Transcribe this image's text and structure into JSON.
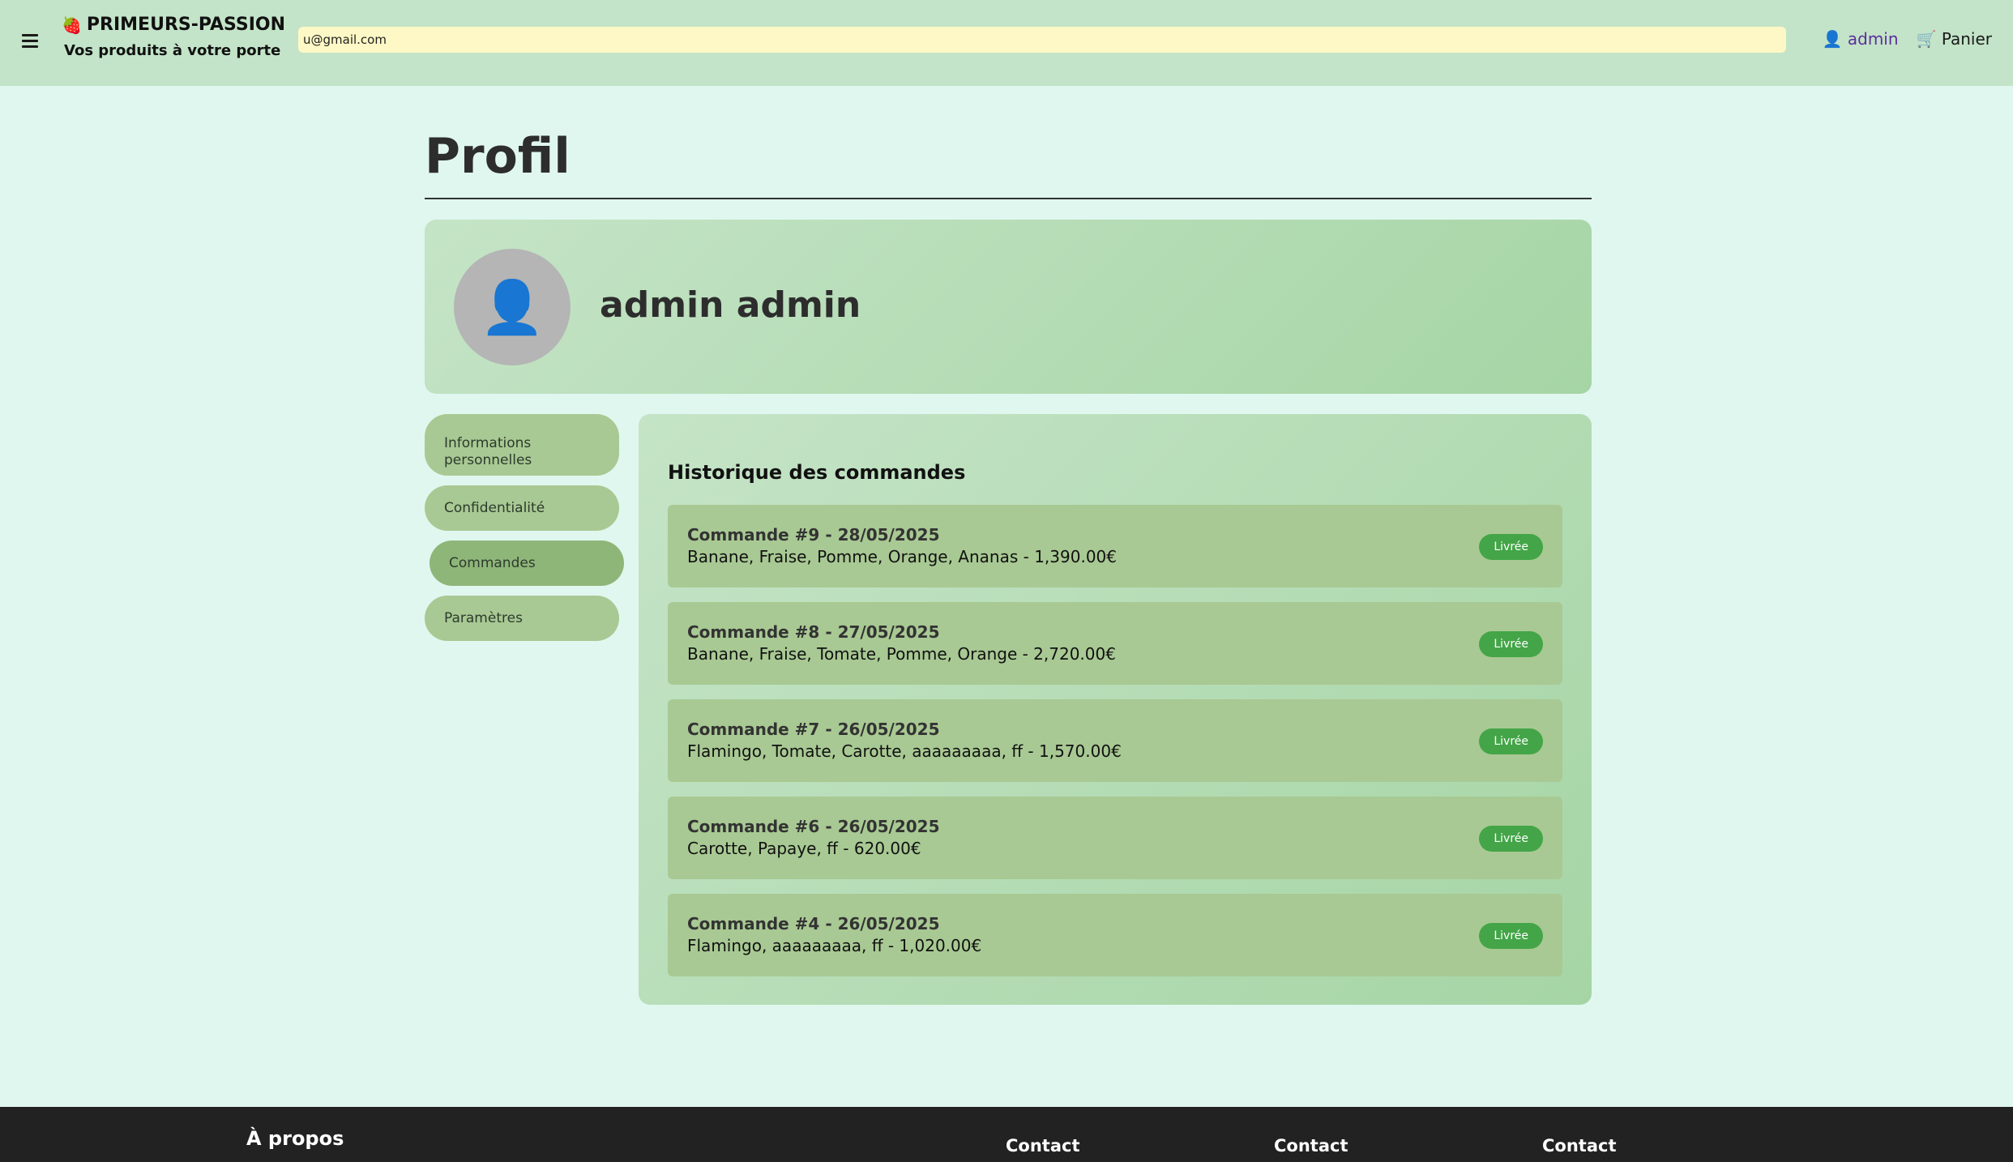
{
  "header": {
    "brand_title": "PRIMEURS-PASSION",
    "brand_tagline": "Vos produits à votre porte",
    "search_value": "u@gmail.com",
    "user_link": "admin",
    "cart_link": "Panier"
  },
  "page": {
    "title": "Profil",
    "profile_name": "admin admin"
  },
  "sidebar": {
    "items": [
      {
        "label": "Informations personnelles"
      },
      {
        "label": "Confidentialité"
      },
      {
        "label": "Commandes"
      },
      {
        "label": "Paramètres"
      }
    ]
  },
  "orders": {
    "title": "Historique des commandes",
    "list": [
      {
        "head": "Commande #9 - 28/05/2025",
        "items": "Banane, Fraise, Pomme, Orange, Ananas - 1,390.00€",
        "status": "Livrée"
      },
      {
        "head": "Commande #8 - 27/05/2025",
        "items": "Banane, Fraise, Tomate, Pomme, Orange - 2,720.00€",
        "status": "Livrée"
      },
      {
        "head": "Commande #7 - 26/05/2025",
        "items": "Flamingo, Tomate, Carotte, aaaaaaaaa, ff - 1,570.00€",
        "status": "Livrée"
      },
      {
        "head": "Commande #6 - 26/05/2025",
        "items": "Carotte, Papaye, ff - 620.00€",
        "status": "Livrée"
      },
      {
        "head": "Commande #4 - 26/05/2025",
        "items": "Flamingo, aaaaaaaaa, ff - 1,020.00€",
        "status": "Livrée"
      }
    ]
  },
  "footer": {
    "about": "À propos",
    "contact_1": "Contact",
    "contact_2": "Contact",
    "contact_3": "Contact"
  }
}
